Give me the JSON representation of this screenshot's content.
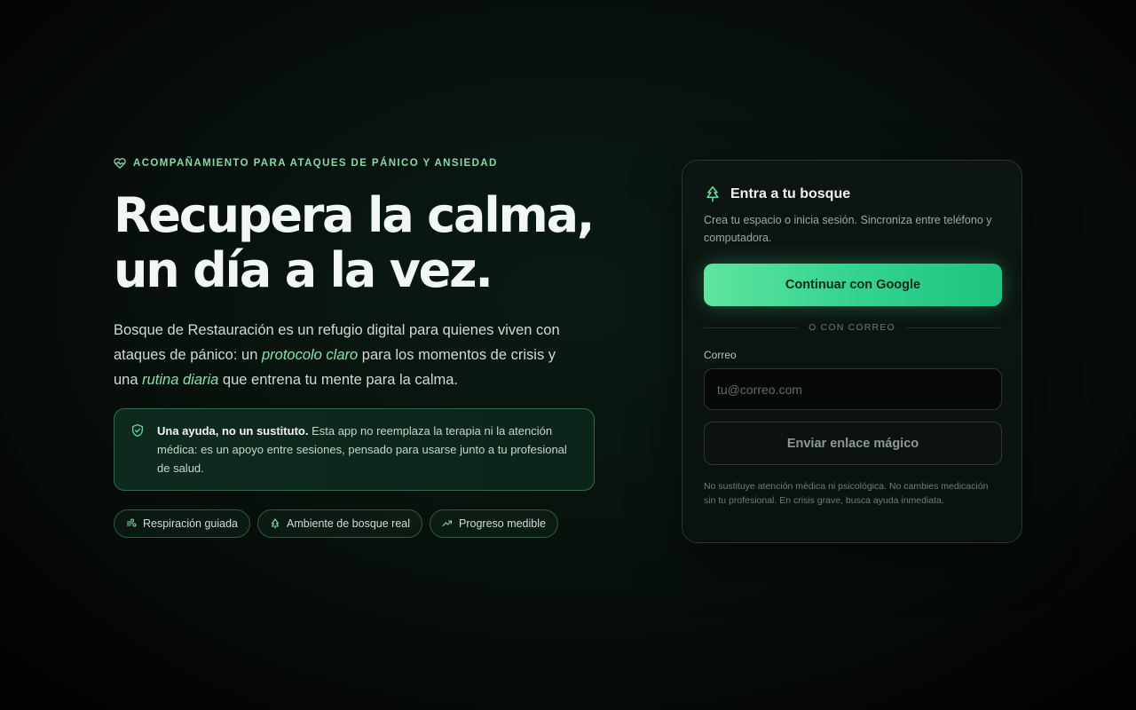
{
  "hero": {
    "eyebrow": "ACOMPAÑAMIENTO PARA ATAQUES DE PÁNICO Y ANSIEDAD",
    "headline_line1": "Recupera la calma,",
    "headline_line2": "un día a la vez.",
    "lead": {
      "part1": "Bosque de Restauración es un refugio digital para quienes viven con ataques de pánico: un ",
      "emph1": "protocolo claro",
      "part2": " para los momentos de crisis y una ",
      "emph2": "rutina diaria",
      "part3": " que entrena tu mente para la calma."
    },
    "notice": {
      "strong": "Una ayuda, no un sustituto.",
      "text": " Esta app no reemplaza la terapia ni la atención médica: es un apoyo entre sesiones, pensado para usarse junto a tu profesional de salud."
    },
    "chips": [
      {
        "label": "Respiración guiada",
        "icon": "wind-icon"
      },
      {
        "label": "Ambiente de bosque real",
        "icon": "tree-icon"
      },
      {
        "label": "Progreso medible",
        "icon": "trending-up-icon"
      }
    ]
  },
  "auth": {
    "title": "Entra a tu bosque",
    "subtitle": "Crea tu espacio o inicia sesión. Sincroniza entre teléfono y computadora.",
    "google_button": "Continuar con Google",
    "divider": "O CON CORREO",
    "email_label": "Correo",
    "email_placeholder": "tu@correo.com",
    "email_value": "",
    "magic_link_button": "Enviar enlace mágico",
    "disclaimer": "No sustituye atención médica ni psicológica. No cambies medicación sin tu profesional. En crisis grave, busca ayuda inmediata."
  },
  "colors": {
    "accent": "#34d390",
    "accent_text": "#86e0ad",
    "background": "#07100c"
  }
}
